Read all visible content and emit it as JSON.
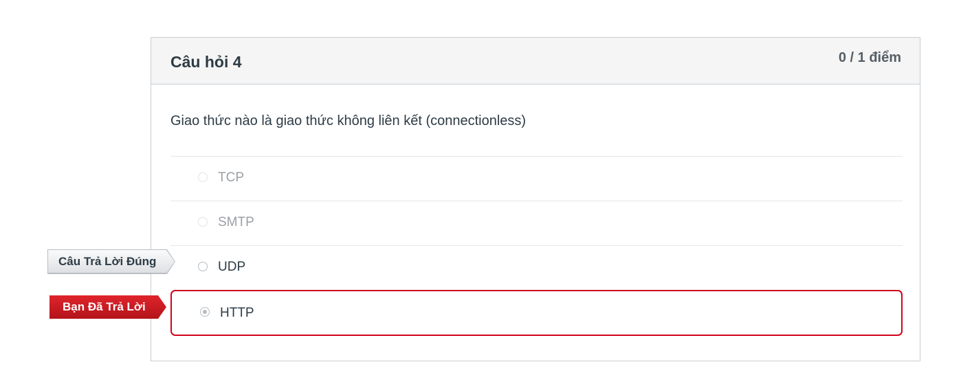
{
  "question": {
    "title": "Câu hỏi 4",
    "points": "0 / 1 điểm",
    "text": "Giao thức nào là giao thức không liên kết (connectionless)"
  },
  "answers": [
    {
      "label": "TCP"
    },
    {
      "label": "SMTP"
    },
    {
      "label": "UDP"
    },
    {
      "label": "HTTP"
    }
  ],
  "flags": {
    "correct": "Câu Trả Lời Đúng",
    "you_answered": "Bạn Đã Trả Lời"
  },
  "colors": {
    "incorrect_border": "#d0021b",
    "you_flag": "#c8161d",
    "correct_flag": "#e8eaec"
  }
}
